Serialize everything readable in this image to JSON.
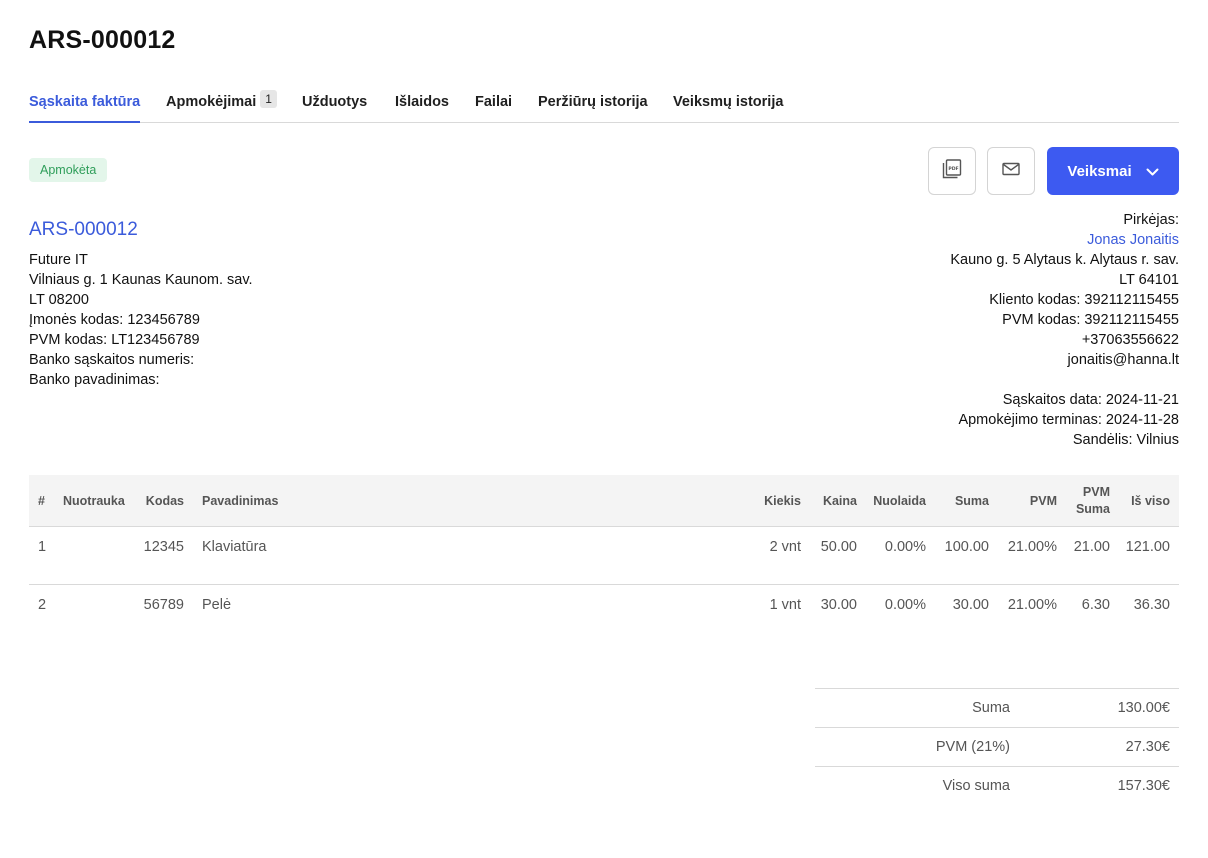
{
  "page_title": "ARS-000012",
  "tabs": [
    {
      "label": "Sąskaita faktūra",
      "active": true
    },
    {
      "label": "Apmokėjimai",
      "badge": "1"
    },
    {
      "label": "Užduotys"
    },
    {
      "label": "Išlaidos"
    },
    {
      "label": "Failai"
    },
    {
      "label": "Peržiūrų istorija"
    },
    {
      "label": "Veiksmų istorija"
    }
  ],
  "status": "Apmokėta",
  "toolbar": {
    "pdf_icon": "pdf-icon",
    "email_icon": "mail-icon",
    "actions_label": "Veiksmai",
    "accent": "#3d5af1"
  },
  "seller": {
    "invoice_no": "ARS-000012",
    "lines": [
      "Future IT",
      "Vilniaus g. 1 Kaunas Kaunom. sav.",
      "LT 08200",
      "Įmonės kodas: 123456789",
      "PVM kodas: LT123456789",
      "Banko sąskaitos numeris:",
      "Banko pavadinimas:"
    ]
  },
  "buyer": {
    "label": "Pirkėjas:",
    "name": "Jonas Jonaitis",
    "lines": [
      "Kauno g. 5 Alytaus k. Alytaus r. sav.",
      "LT 64101",
      "Kliento kodas: 392112115455",
      "PVM kodas: 392112115455",
      "+37063556622",
      "jonaitis@hanna.lt"
    ],
    "dates": [
      "Sąskaitos data: 2024-11-21",
      "Apmokėjimo terminas: 2024-11-28",
      "Sandėlis: Vilnius"
    ]
  },
  "table": {
    "headers": [
      "#",
      "Nuotrauka",
      "Kodas",
      "Pavadinimas",
      "Kiekis",
      "Kaina",
      "Nuolaida",
      "Suma",
      "PVM",
      "PVM Suma",
      "Iš viso"
    ],
    "rows": [
      [
        "1",
        "",
        "12345",
        "Klaviatūra",
        "2 vnt",
        "50.00",
        "0.00%",
        "100.00",
        "21.00%",
        "21.00",
        "121.00"
      ],
      [
        "2",
        "",
        "56789",
        "Pelė",
        "1 vnt",
        "30.00",
        "0.00%",
        "30.00",
        "21.00%",
        "6.30",
        "36.30"
      ]
    ]
  },
  "totals": [
    {
      "label": "Suma",
      "value": "130.00€"
    },
    {
      "label": "PVM (21%)",
      "value": "27.30€"
    },
    {
      "label": "Viso suma",
      "value": "157.30€"
    }
  ]
}
